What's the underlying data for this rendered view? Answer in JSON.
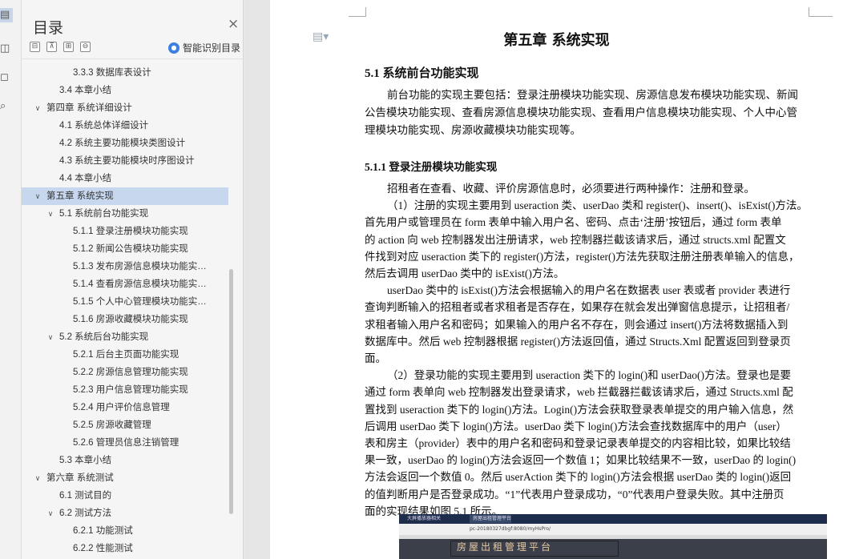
{
  "sidebar_icons": [
    "page-view",
    "bookmark",
    "comment",
    "search"
  ],
  "toc": {
    "title": "目录",
    "close_label": "×",
    "tools": [
      "⊟",
      "⊼",
      "⊞",
      "⊖"
    ],
    "smart_label": "智能识别目录",
    "items": [
      {
        "label": "3.3.3  数据库表设计",
        "level": 3,
        "chevron": ""
      },
      {
        "label": "3.4  本章小结",
        "level": 2,
        "chevron": ""
      },
      {
        "label": "第四章  系统详细设计",
        "level": 1,
        "chevron": "v"
      },
      {
        "label": "4.1  系统总体详细设计",
        "level": 2,
        "chevron": ""
      },
      {
        "label": "4.2  系统主要功能模块类图设计",
        "level": 2,
        "chevron": ""
      },
      {
        "label": "4.3  系统主要功能模块时序图设计",
        "level": 2,
        "chevron": ""
      },
      {
        "label": "4.4  本章小结",
        "level": 2,
        "chevron": ""
      },
      {
        "label": "第五章  系统实现",
        "level": 1,
        "chevron": "v",
        "selected": true
      },
      {
        "label": "5.1  系统前台功能实现",
        "level": 2,
        "chevron": "v"
      },
      {
        "label": "5.1.1  登录注册模块功能实现",
        "level": 3,
        "chevron": ""
      },
      {
        "label": "5.1.2  新闻公告模块功能实现",
        "level": 3,
        "chevron": ""
      },
      {
        "label": "5.1.3  发布房源信息模块功能实…",
        "level": 3,
        "chevron": ""
      },
      {
        "label": "5.1.4  查看房源信息模块功能实…",
        "level": 3,
        "chevron": ""
      },
      {
        "label": "5.1.5  个人中心管理模块功能实…",
        "level": 3,
        "chevron": ""
      },
      {
        "label": "5.1.6  房源收藏模块功能实现",
        "level": 3,
        "chevron": ""
      },
      {
        "label": "5.2  系统后台功能实现",
        "level": 2,
        "chevron": "v"
      },
      {
        "label": "5.2.1  后台主页面功能实现",
        "level": 3,
        "chevron": ""
      },
      {
        "label": "5.2.2  房源信息管理功能实现",
        "level": 3,
        "chevron": ""
      },
      {
        "label": "5.2.3  用户信息管理功能实现",
        "level": 3,
        "chevron": ""
      },
      {
        "label": "5.2.4  用户评价信息管理",
        "level": 3,
        "chevron": ""
      },
      {
        "label": "5.2.5  房源收藏管理",
        "level": 3,
        "chevron": ""
      },
      {
        "label": "5.2.6  管理员信息注销管理",
        "level": 3,
        "chevron": ""
      },
      {
        "label": "5.3  本章小结",
        "level": 2,
        "chevron": ""
      },
      {
        "label": "第六章  系统测试",
        "level": 1,
        "chevron": "v"
      },
      {
        "label": "6.1  测试目的",
        "level": 2,
        "chevron": ""
      },
      {
        "label": "6.2  测试方法",
        "level": 2,
        "chevron": "v"
      },
      {
        "label": "6.2.1  功能测试",
        "level": 3,
        "chevron": ""
      },
      {
        "label": "6.2.2  性能测试",
        "level": 3,
        "chevron": ""
      }
    ]
  },
  "document": {
    "chapter_title": "第五章  系统实现",
    "section_title": "5.1  系统前台功能实现",
    "section_lines": [
      "前台功能的实现主要包括：登录注册模块功能实现、房源信息发布模块功能实现、新闻",
      "公告模块功能实现、查看房源信息模块功能实现、查看用户信息模块功能实现、个人中心管",
      "理模块功能实现、房源收藏模块功能实现等。"
    ],
    "subsection_title": "5.1.1  登录注册模块功能实现",
    "body_lines": [
      "招租者在查看、收藏、评价房源信息时，必须要进行两种操作：注册和登录。",
      "（1）注册的实现主要用到 useraction 类、userDao 类和 register()、insert()、isExist()方法。",
      "首先用户或管理员在 form 表单中输入用户名、密码、点击‘注册’按钮后，通过 form 表单",
      "的 action 向 web 控制器发出注册请求，web 控制器拦截该请求后，通过 structs.xml 配置文",
      "件找到对应 useraction 类下的 register()方法，register()方法先获取注册注册表单输入的信息，",
      "然后去调用 userDao 类中的 isExist()方法。",
      "userDao 类中的 isExist()方法会根据输入的用户名在数据表 user 表或者 provider 表进行",
      "查询判断输入的招租者或者求租者是否存在，如果存在就会发出弹窗信息提示，让招租者/",
      "求租者输入用户名和密码；如果输入的用户名不存在，则会通过 insert()方法将数据插入到",
      "数据库中。然后 web 控制器根据 register()方法返回值，通过 Structs.Xml 配置返回到登录页",
      "面。",
      "（2）登录功能的实现主要用到 useraction 类下的 login()和 userDao()方法。登录也是要",
      "通过 form 表单向 web 控制器发出登录请求，web 拦截器拦截该请求后，通过 Structs.xml 配",
      "置找到 useraction 类下的 login()方法。Login()方法会获取登录表单提交的用户输入信息，然",
      "后调用 userDao 类下 login()方法。userDao 类下 login()方法会查找数据库中的用户（user）",
      "表和房主（provider）表中的用户名和密码和登录记录表单提交的内容相比较，如果比较结",
      "果一致，userDao 的 login()方法会返回一个数值 1；如果比较结果不一致，userDao 的 login()",
      "方法会返回一个数值 0。然后 userAction 类下的 login()方法会根据 userDao 类的 login()返回",
      "的值判断用户是否登录成功。“1”代表用户登录成功，“0”代表用户登录失败。其中注册页",
      "面的实现结果如图 5.1 所示。"
    ],
    "figure": {
      "tabs": [
        "大屏播放器相关",
        "房屋出租管理平台"
      ],
      "url": "pc-20180327dbgf:8080/myHsPro/",
      "banner": "房屋出租管理平台"
    }
  }
}
